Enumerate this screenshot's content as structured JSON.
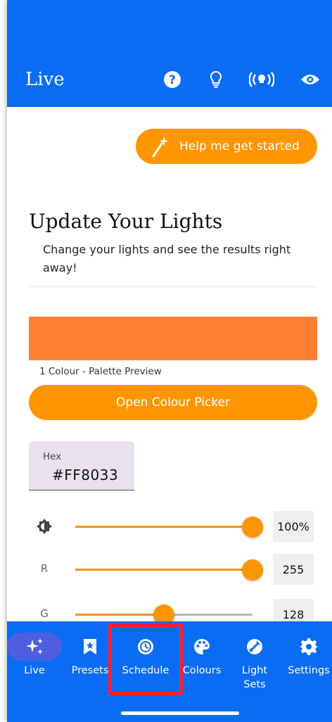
{
  "app_bar": {
    "title": "Live",
    "icons": [
      "help-icon",
      "bulb-icon",
      "broadcast-icon",
      "eye-icon"
    ]
  },
  "help_button": {
    "label": "Help me get started",
    "icon": "magic-wand-icon"
  },
  "section": {
    "title": "Update Your Lights",
    "subtitle": "Change your lights and see the results right away!"
  },
  "palette": {
    "color": "#FF8033",
    "caption": "1 Colour - Palette Preview",
    "open_picker_label": "Open Colour Picker"
  },
  "hex_field": {
    "label": "Hex",
    "value": "#FF8033"
  },
  "sliders": [
    {
      "name": "brightness",
      "label": "",
      "icon": "brightness-icon",
      "value": 100,
      "max": 100,
      "display": "100%"
    },
    {
      "name": "red",
      "label": "R",
      "value": 255,
      "max": 255,
      "display": "255"
    },
    {
      "name": "green",
      "label": "G",
      "value": 128,
      "max": 255,
      "display": "128"
    }
  ],
  "bottom_nav": {
    "items": [
      {
        "label": "Live",
        "icon": "sparkles-icon",
        "active": true
      },
      {
        "label": "Presets",
        "icon": "bookmark-star-icon"
      },
      {
        "label": "Schedule",
        "icon": "clock-icon"
      },
      {
        "label": "Colours",
        "icon": "palette-icon"
      },
      {
        "label": "Light Sets",
        "label_line1": "Light",
        "label_line2": "Sets",
        "icon": "color-lens-icon"
      },
      {
        "label": "Settings",
        "icon": "gear-icon"
      }
    ]
  },
  "colors": {
    "primary": "#0A6CF5",
    "accent": "#FF9500",
    "preview": "#FF8033",
    "highlight": "#FF1F2F"
  }
}
